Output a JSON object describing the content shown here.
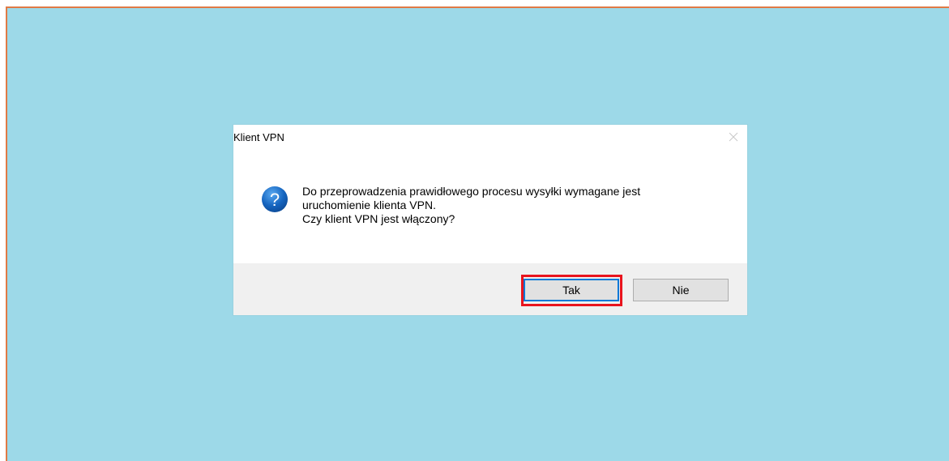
{
  "dialog": {
    "title": "Klient VPN",
    "icon": "question-icon",
    "message_lines": [
      "Do przeprowadzenia prawidłowego procesu wysyłki wymagane jest",
      "uruchomienie klienta VPN.",
      "Czy klient VPN jest włączony?"
    ],
    "buttons": {
      "yes_label": "Tak",
      "no_label": "Nie"
    }
  },
  "colors": {
    "background": "#9dd9e8",
    "frame_border": "#e07a45",
    "highlight": "#e8141e",
    "icon_blue": "#1565c0",
    "focus_blue": "#0078d7"
  }
}
